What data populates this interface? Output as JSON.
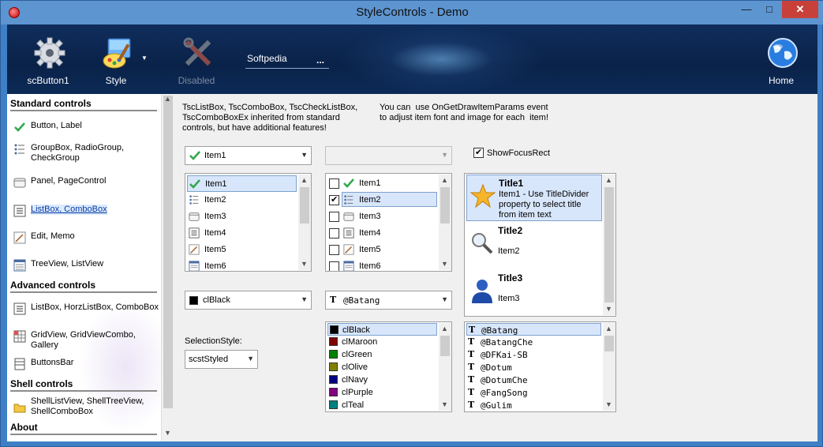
{
  "window": {
    "title": "StyleControls - Demo",
    "minimize": "—",
    "maximize": "□",
    "close": "✕"
  },
  "ribbon": {
    "buttons": [
      {
        "label": "scButton1",
        "icon": "gear-icon"
      },
      {
        "label": "Style",
        "icon": "paint-palette-icon"
      },
      {
        "label": "Disabled",
        "icon": "tools-icon"
      },
      {
        "label": "Home",
        "icon": "globe-icon"
      }
    ],
    "edit_value": "Softpedia",
    "edit_ellipsis": "..."
  },
  "sidebar": {
    "sections": [
      {
        "title": "Standard controls",
        "items": [
          {
            "label": "Button, Label",
            "icon": "checkmark-icon"
          },
          {
            "label": "GroupBox, RadioGroup,\nCheckGroup",
            "icon": "radio-list-icon"
          },
          {
            "label": "Panel, PageControl",
            "icon": "panel-icon"
          },
          {
            "label": "ListBox, ComboBox",
            "icon": "listbox-icon",
            "selected": true
          },
          {
            "label": "Edit, Memo",
            "icon": "edit-icon"
          },
          {
            "label": "TreeView, ListView",
            "icon": "treeview-icon"
          }
        ]
      },
      {
        "title": "Advanced controls",
        "items": [
          {
            "label": "ListBox, HorzListBox, ComboBox",
            "icon": "list-icon"
          },
          {
            "label": "GridView, GridViewCombo, Gallery",
            "icon": "grid-icon"
          },
          {
            "label": "ButtonsBar",
            "icon": "buttonsbar-icon"
          }
        ]
      },
      {
        "title": "Shell controls",
        "items": [
          {
            "label": "ShellListView, ShellTreeView,\nShellComboBox",
            "icon": "folder-icon"
          }
        ]
      },
      {
        "title": "About",
        "items": []
      }
    ]
  },
  "main": {
    "intro_left": "TscListBox, TscComboBox, TscCheckListBox,\nTscComboBoxEx inherited from standard\ncontrols, but have additional features!",
    "intro_right": "You can  use OnGetDrawItemParams event\nto adjust item font and image for each  item!",
    "combo1_value": "Item1",
    "show_focus_rect_label": "ShowFocusRect",
    "show_focus_rect_checked": true,
    "list_items": [
      "Item1",
      "Item2",
      "Item3",
      "Item4",
      "Item5",
      "Item6"
    ],
    "check_states": [
      false,
      true,
      false,
      false,
      false,
      false
    ],
    "title_list": [
      {
        "title": "Title1",
        "text": "Item1 - Use TitleDivider\nproperty to select title\nfrom item text",
        "icon": "star-icon"
      },
      {
        "title": "Title2",
        "text": "Item2",
        "icon": "magnifier-icon"
      },
      {
        "title": "Title3",
        "text": "Item3",
        "icon": "user-icon"
      }
    ],
    "color_combo_value": "clBlack",
    "font_combo_value": "@Batang",
    "selection_style_label": "SelectionStyle:",
    "selection_style_value": "scstStyled",
    "colors": [
      {
        "name": "clBlack",
        "hex": "#000000"
      },
      {
        "name": "clMaroon",
        "hex": "#800000"
      },
      {
        "name": "clGreen",
        "hex": "#008000"
      },
      {
        "name": "clOlive",
        "hex": "#808000"
      },
      {
        "name": "clNavy",
        "hex": "#000080"
      },
      {
        "name": "clPurple",
        "hex": "#800080"
      },
      {
        "name": "clTeal",
        "hex": "#008080"
      }
    ],
    "fonts": [
      "@Batang",
      "@BatangChe",
      "@DFKai-SB",
      "@Dotum",
      "@DotumChe",
      "@FangSong",
      "@Gulim"
    ],
    "tt_glyph": "T"
  }
}
